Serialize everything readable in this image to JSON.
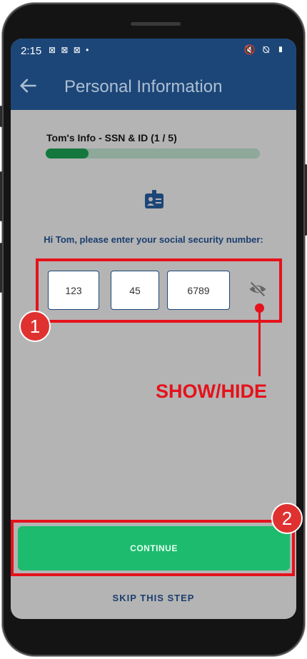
{
  "status_bar": {
    "time": "2:15",
    "left_icons": "⊠ ⊠ ⊠ •",
    "right_icons": "🔇 ⦰ ▮"
  },
  "app_bar": {
    "title": "Personal Information"
  },
  "progress": {
    "label": "Tom's Info - SSN & ID (1 / 5)",
    "current_step": 1,
    "total_steps": 5,
    "fraction": 0.2
  },
  "form": {
    "prompt": "Hi Tom, please enter your social security number:",
    "ssn_part1": "123",
    "ssn_part2": "45",
    "ssn_part3": "6789"
  },
  "buttons": {
    "continue_label": "CONTINUE",
    "skip_label": "SKIP THIS STEP"
  },
  "annotations": {
    "badge_1": "1",
    "badge_2": "2",
    "show_hide_label": "SHOW/HIDE"
  },
  "colors": {
    "header": "#1c4677",
    "progress_fill": "#14773d",
    "continue": "#1dbb6d",
    "annotation": "#e5121b"
  }
}
